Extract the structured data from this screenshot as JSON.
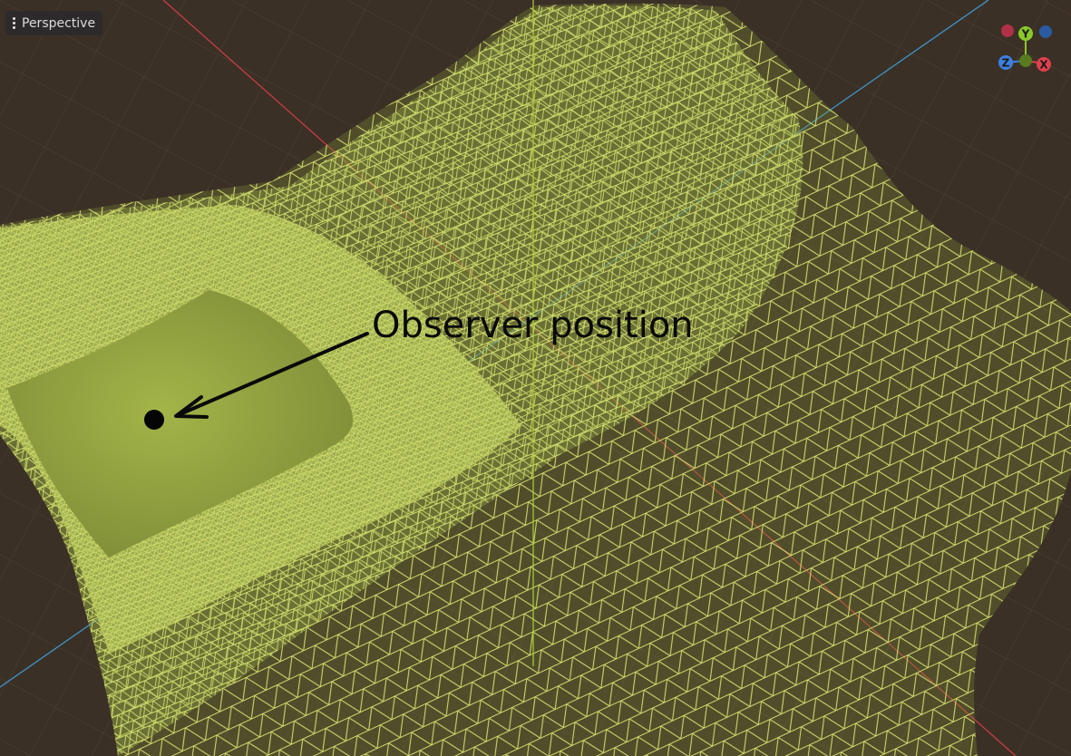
{
  "viewport": {
    "view_mode_label": "Perspective",
    "menu_icon": "kebab-menu-icon"
  },
  "gizmo": {
    "y_label": "Y",
    "z_label": "Z",
    "x_label": "X",
    "colors": {
      "x": "#e0404e",
      "y": "#8ac82a",
      "z": "#3c80e0"
    }
  },
  "annotation": {
    "text": "Observer position",
    "marker_icon": "observer-dot-icon",
    "arrow_icon": "arrow-icon"
  },
  "colors": {
    "background": "#3b3026",
    "wireframe": "#cdd76c",
    "terrain_fill": "#96a844",
    "x_axis": "#d23c46",
    "z_axis": "#3c9ad2",
    "y_axis": "#a8d232"
  }
}
